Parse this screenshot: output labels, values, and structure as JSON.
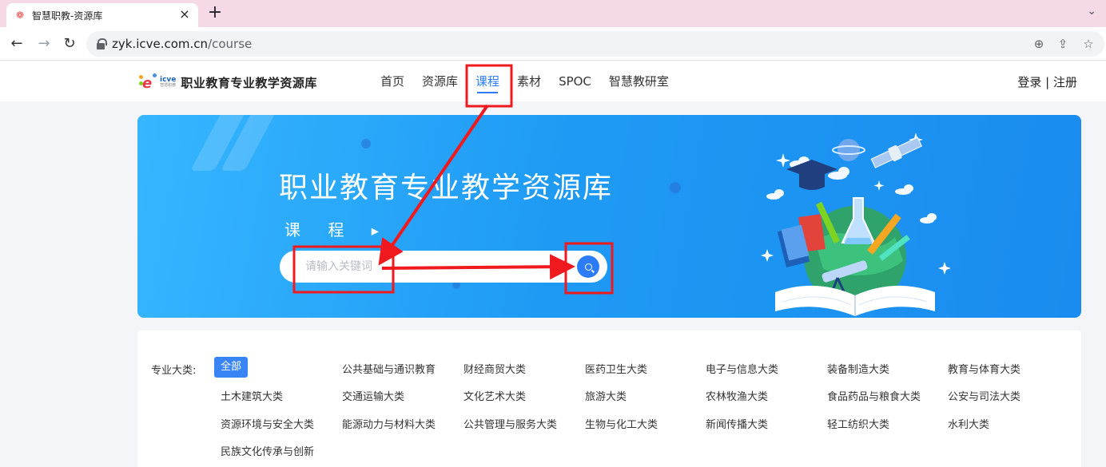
{
  "browser": {
    "tab_title": "智慧职教-资源库",
    "tab_favicon": "icve-logo-icon",
    "tab_close": "×",
    "new_tab": "+",
    "url_domain": "zyk.icve.com.cn",
    "url_path": "/course"
  },
  "site": {
    "logo_brand": "icve",
    "logo_title": "职业教育专业教学资源库",
    "nav": [
      "首页",
      "资源库",
      "课程",
      "素材",
      "SPOC",
      "智慧教研室"
    ],
    "active_nav": "课程",
    "auth_login": "登录",
    "auth_sep": " | ",
    "auth_register": "注册"
  },
  "banner": {
    "title": "职业教育专业教学资源库",
    "subtitle": "课 程",
    "search_placeholder": "请输入关键词"
  },
  "categories": {
    "label": "专业大类:",
    "all": "全部",
    "items": [
      "公共基础与通识教育",
      "财经商贸大类",
      "医药卫生大类",
      "电子与信息大类",
      "装备制造大类",
      "教育与体育大类",
      "土木建筑大类",
      "交通运输大类",
      "文化艺术大类",
      "旅游大类",
      "农林牧渔大类",
      "食品药品与粮食大类",
      "公安与司法大类",
      "资源环境与安全大类",
      "能源动力与材料大类",
      "公共管理与服务大类",
      "生物与化工大类",
      "新闻传播大类",
      "轻工纺织大类",
      "水利大类",
      "民族文化传承与创新"
    ]
  },
  "colors": {
    "accent": "#2b7cf6",
    "annotation": "#f0191e",
    "tab_bar": "#f5d9e6"
  }
}
